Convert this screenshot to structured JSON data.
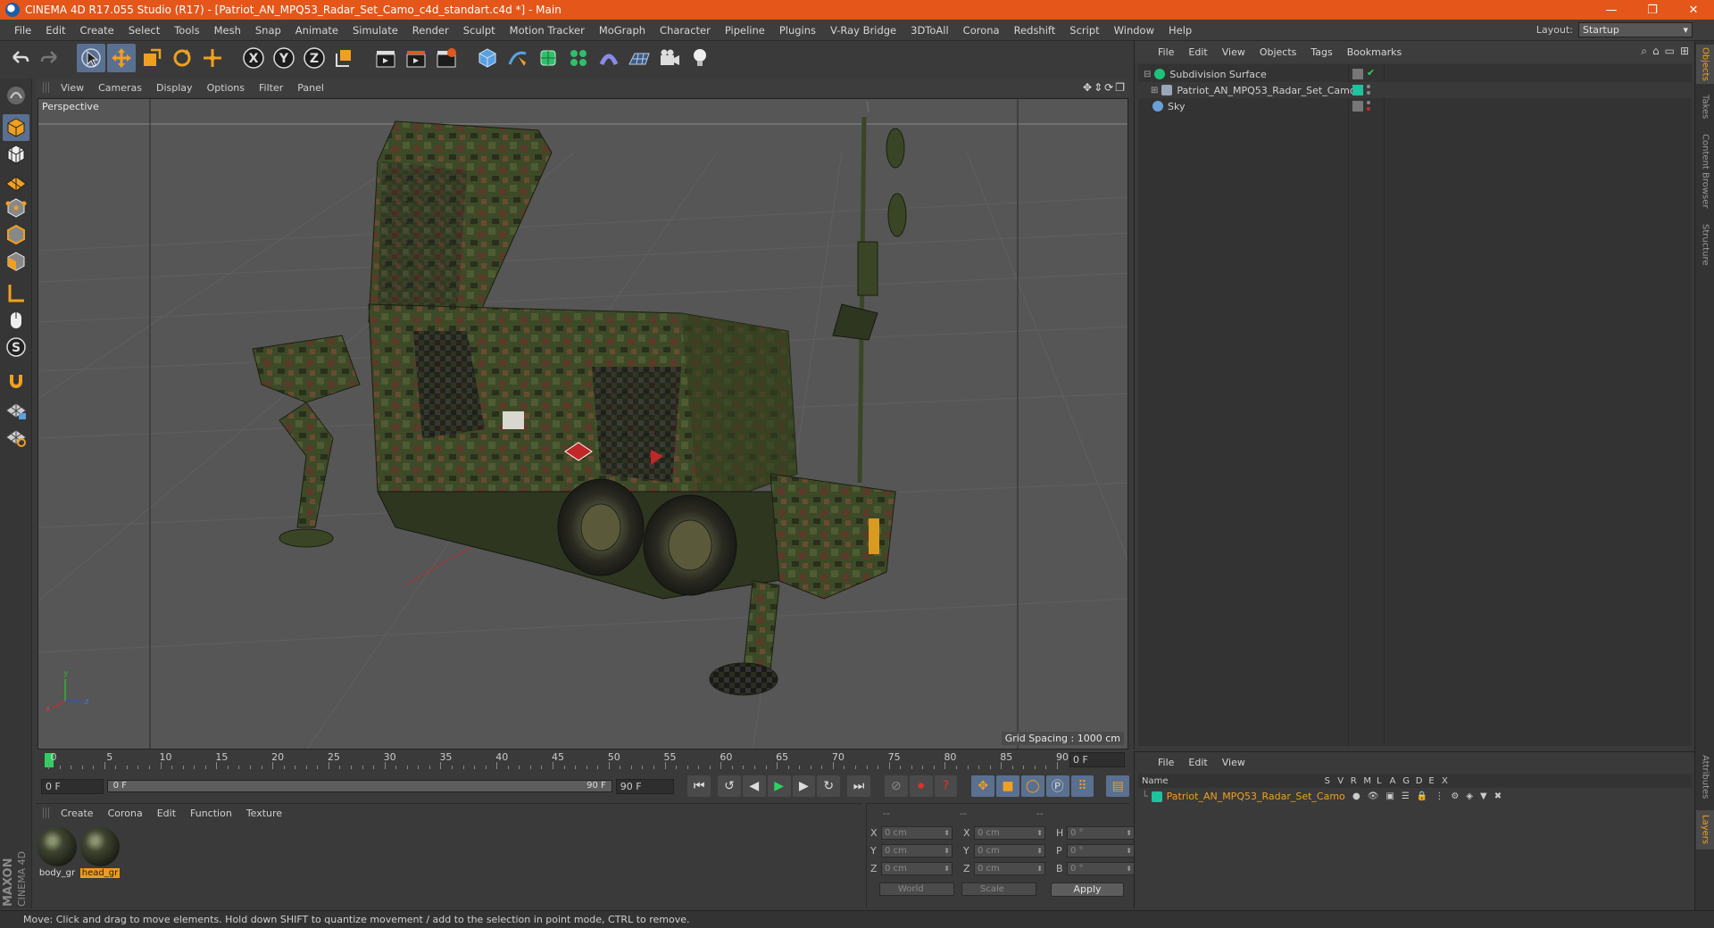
{
  "window": {
    "title": "CINEMA 4D R17.055 Studio (R17) - [Patriot_AN_MPQ53_Radar_Set_Camo_c4d_standart.c4d *] - Main",
    "controls": {
      "minimize": "—",
      "maximize": "❐",
      "close": "✕"
    }
  },
  "menu": {
    "items": [
      "File",
      "Edit",
      "Create",
      "Select",
      "Tools",
      "Mesh",
      "Snap",
      "Animate",
      "Simulate",
      "Render",
      "Sculpt",
      "Motion Tracker",
      "MoGraph",
      "Character",
      "Pipeline",
      "Plugins",
      "V-Ray Bridge",
      "3DToAll",
      "Corona",
      "Redshift",
      "Script",
      "Window",
      "Help"
    ],
    "layout_label": "Layout:",
    "layout_value": "Startup"
  },
  "viewport": {
    "menu": [
      "View",
      "Cameras",
      "Display",
      "Options",
      "Filter",
      "Panel"
    ],
    "camera_label": "Perspective",
    "grid_spacing": "Grid Spacing : 1000 cm",
    "nav_icons": [
      "move-view-icon",
      "zoom-view-icon",
      "rotate-view-icon",
      "maximize-view-icon"
    ]
  },
  "timeline": {
    "labels": [
      "0",
      "5",
      "10",
      "15",
      "20",
      "25",
      "30",
      "35",
      "40",
      "45",
      "50",
      "55",
      "60",
      "65",
      "70",
      "75",
      "80",
      "85",
      "90"
    ],
    "current_frame": "0 F",
    "start_field": "0 F",
    "range_start": "0 F",
    "range_end": "90 F",
    "end_field": "90 F"
  },
  "material_manager": {
    "menu": [
      "Create",
      "Corona",
      "Edit",
      "Function",
      "Texture"
    ],
    "materials": [
      {
        "name": "body_gr",
        "selected": false
      },
      {
        "name": "head_gr",
        "selected": true
      }
    ]
  },
  "coordinates": {
    "header": [
      "--",
      "--",
      "--"
    ],
    "rows": [
      {
        "l1": "X",
        "v1": "0 cm",
        "l2": "X",
        "v2": "0 cm",
        "l3": "H",
        "v3": "0 °"
      },
      {
        "l1": "Y",
        "v1": "0 cm",
        "l2": "Y",
        "v2": "0 cm",
        "l3": "P",
        "v3": "0 °"
      },
      {
        "l1": "Z",
        "v1": "0 cm",
        "l2": "Z",
        "v2": "0 cm",
        "l3": "B",
        "v3": "0 °"
      }
    ],
    "space": "World",
    "mode": "Scale",
    "apply": "Apply"
  },
  "object_manager": {
    "menu": [
      "File",
      "Edit",
      "View",
      "Objects",
      "Tags",
      "Bookmarks"
    ],
    "objects": [
      {
        "name": "Subdivision Surface",
        "color": "#1fc27a"
      },
      {
        "name": "Patriot_AN_MPQ53_Radar_Set_Camo",
        "color": "#9aa7b8"
      },
      {
        "name": "Sky",
        "color": "#6aa0d8"
      }
    ]
  },
  "layer_manager": {
    "menu": [
      "File",
      "Edit",
      "View"
    ],
    "columns": [
      "Name",
      "S",
      "V",
      "R",
      "M",
      "L",
      "A",
      "G",
      "D",
      "E",
      "X"
    ],
    "layers": [
      {
        "name": "Patriot_AN_MPQ53_Radar_Set_Camo",
        "color": "#1fc2a0"
      }
    ]
  },
  "right_tabs": [
    "Objects",
    "Takes",
    "Content Browser",
    "Structure",
    "Attributes",
    "Layers"
  ],
  "status": "Move: Click and drag to move elements. Hold down SHIFT to quantize movement / add to the selection in point mode, CTRL to remove.",
  "brand": {
    "line1": "MAXON",
    "line2": "CINEMA 4D"
  },
  "colors": {
    "titlebar": "#e4561a",
    "accent": "#f09a1e",
    "active_tool": "#5a7090"
  }
}
